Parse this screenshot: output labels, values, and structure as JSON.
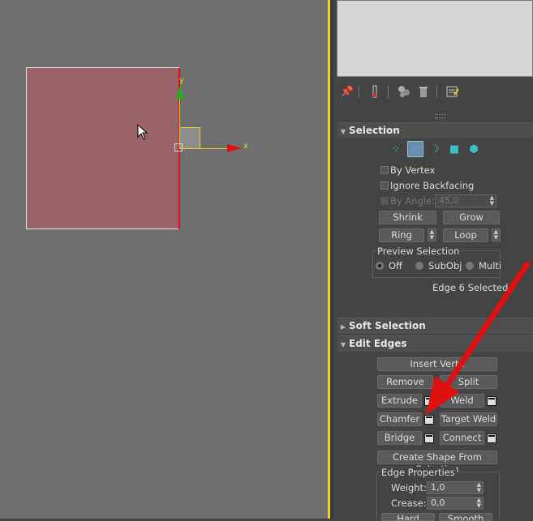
{
  "viewport": {
    "axis_y": "y",
    "axis_x": "x"
  },
  "toolbar": {
    "icons": [
      "pin-icon",
      "stack-icon",
      "spheres-icon",
      "trash-icon",
      "configure-icon"
    ]
  },
  "selection": {
    "title": "Selection",
    "by_vertex": "By Vertex",
    "ignore_backfacing": "Ignore Backfacing",
    "by_angle": "By Angle:",
    "angle_value": "45,0",
    "shrink": "Shrink",
    "grow": "Grow",
    "ring": "Ring",
    "loop": "Loop",
    "preview_title": "Preview Selection",
    "preview_off": "Off",
    "preview_subobj": "SubObj",
    "preview_multi": "Multi",
    "status": "Edge 6 Selected"
  },
  "soft_selection": {
    "title": "Soft Selection"
  },
  "edit_edges": {
    "title": "Edit Edges",
    "insert_vertex": "Insert Verte",
    "remove": "Remove",
    "split": "Split",
    "extrude": "Extrude",
    "weld": "Weld",
    "chamfer": "Chamfer",
    "target_weld": "Target Weld",
    "bridge": "Bridge",
    "connect": "Connect",
    "create_shape": "Create Shape From Selection",
    "edge_props": "Edge Properties",
    "weight_label": "Weight:",
    "weight_value": "1,0",
    "crease_label": "Crease:",
    "crease_value": "0,0",
    "bottom_left": "Hard",
    "bottom_right": "Smooth"
  },
  "colors": {
    "accent": "#e8d32a",
    "arrow": "#cc1111",
    "plane": "#9a6367"
  }
}
